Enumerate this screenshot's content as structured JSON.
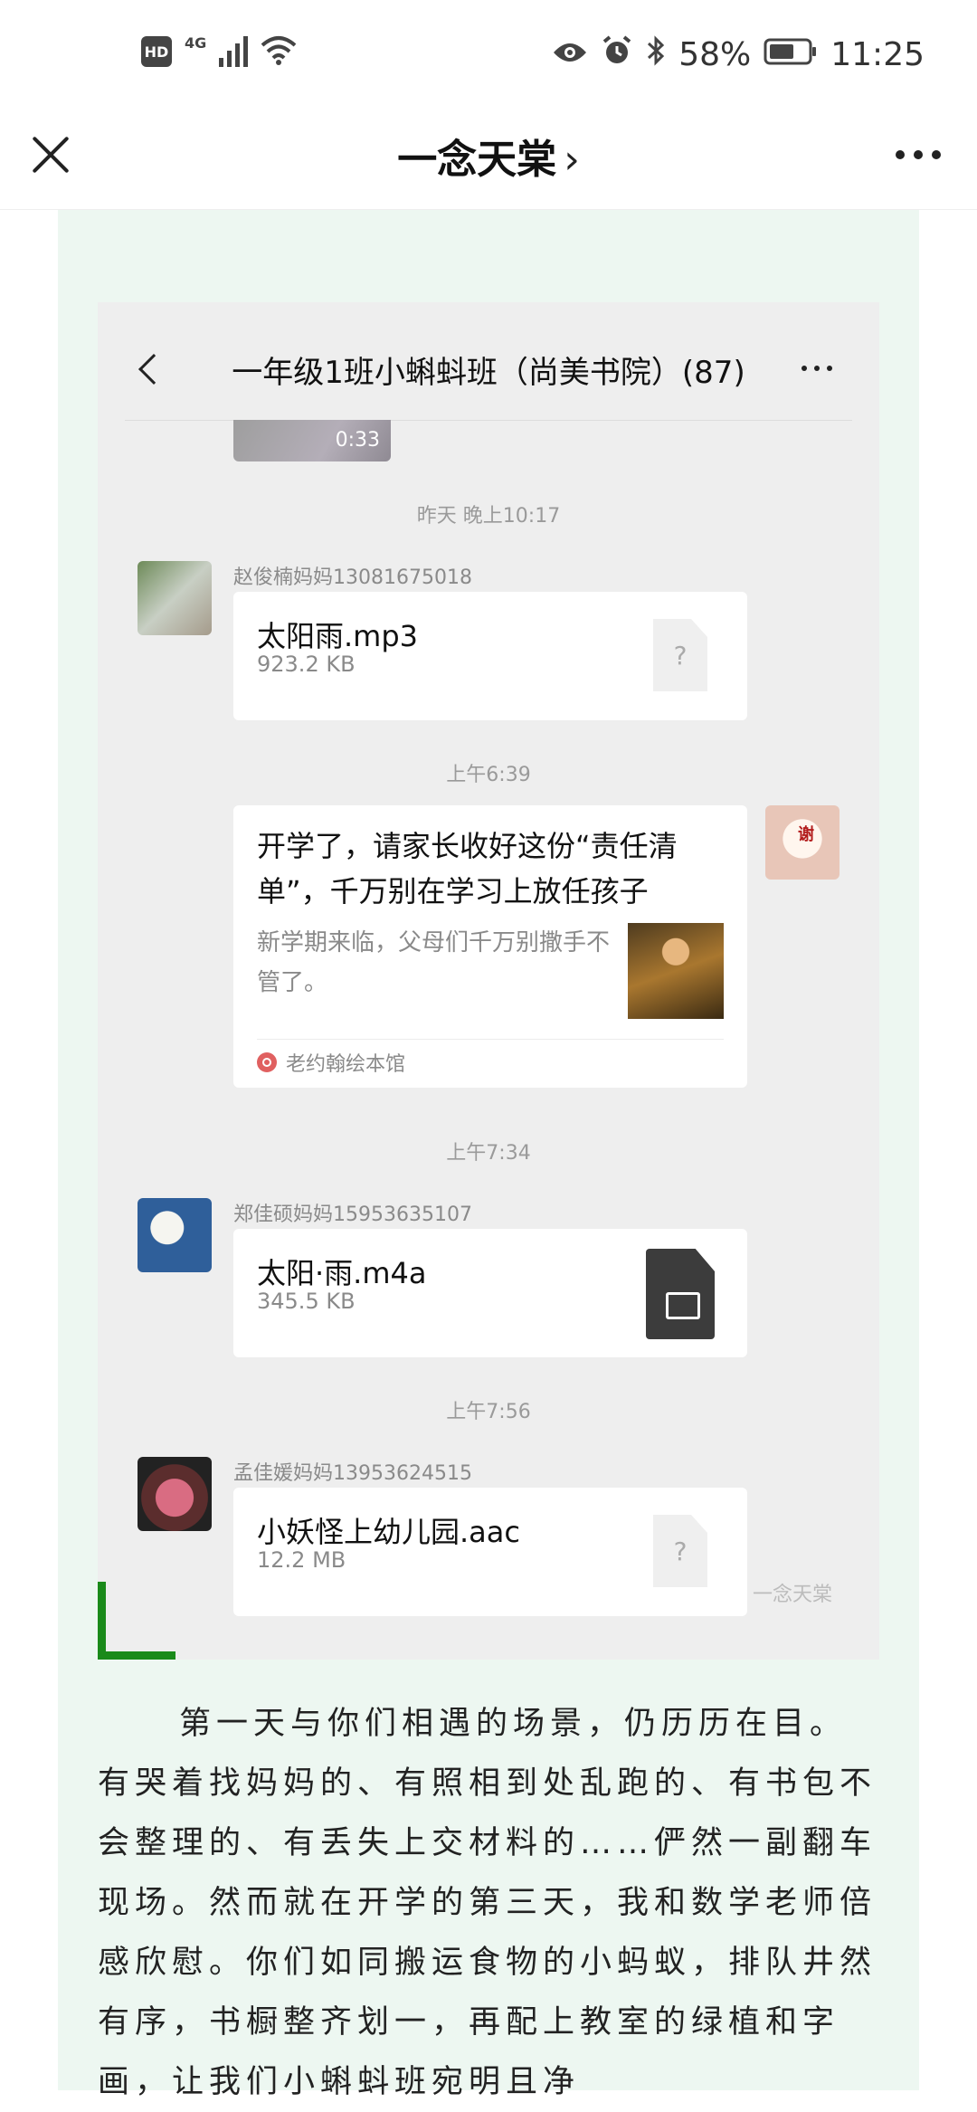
{
  "status_bar": {
    "left_badges": [
      "HD",
      "4G"
    ],
    "battery": "58%",
    "time": "11:25"
  },
  "header": {
    "title": "一念天棠",
    "chevron": "›"
  },
  "chat": {
    "title": "一年级1班小蝌蚪班（尚美书院）(87)",
    "video_duration": "0:33",
    "messages": [
      {
        "time": "昨天 晚上10:17"
      },
      {
        "sender": "赵俊楠妈妈13081675018",
        "file_name": "太阳雨.mp3",
        "file_size": "923.2 KB",
        "file_icon": "unknown-file-icon"
      },
      {
        "time": "上午6:39"
      },
      {
        "link_title": "开学了，请家长收好这份“责任清单”，千万别在学习上放任孩子",
        "link_desc": "新学期来临，父母们千万别撒手不管了。",
        "link_source": "老约翰绘本馆",
        "avatar_text": "谢"
      },
      {
        "time": "上午7:34"
      },
      {
        "sender": "郑佳硕妈妈15953635107",
        "file_name": "太阳·雨.m4a",
        "file_size": "345.5 KB",
        "file_icon": "video-file-icon"
      },
      {
        "time": "上午7:56"
      },
      {
        "sender": "孟佳媛妈妈13953624515",
        "file_name": "小妖怪上幼儿园.aac",
        "file_size": "12.2 MB",
        "file_icon": "unknown-file-icon"
      }
    ],
    "unknown_file_glyph": "?",
    "watermark": "一念天棠"
  },
  "article": {
    "paragraph": "第一天与你们相遇的场景，仍历历在目。有哭着找妈妈的、有照相到处乱跑的、有书包不会整理的、有丢失上交材料的……俨然一副翻车现场。然而就在开学的第三天，我和数学老师倍感欣慰。你们如同搬运食物的小蚂蚁，排队井然有序，书橱整齐划一，再配上教室的绿植和字画，让我们小蝌蚪班宛明且净"
  },
  "colors": {
    "article_bg": "#edf7f1",
    "corner_mark": "#1a8a1a",
    "chat_bg": "#eeeeee"
  }
}
